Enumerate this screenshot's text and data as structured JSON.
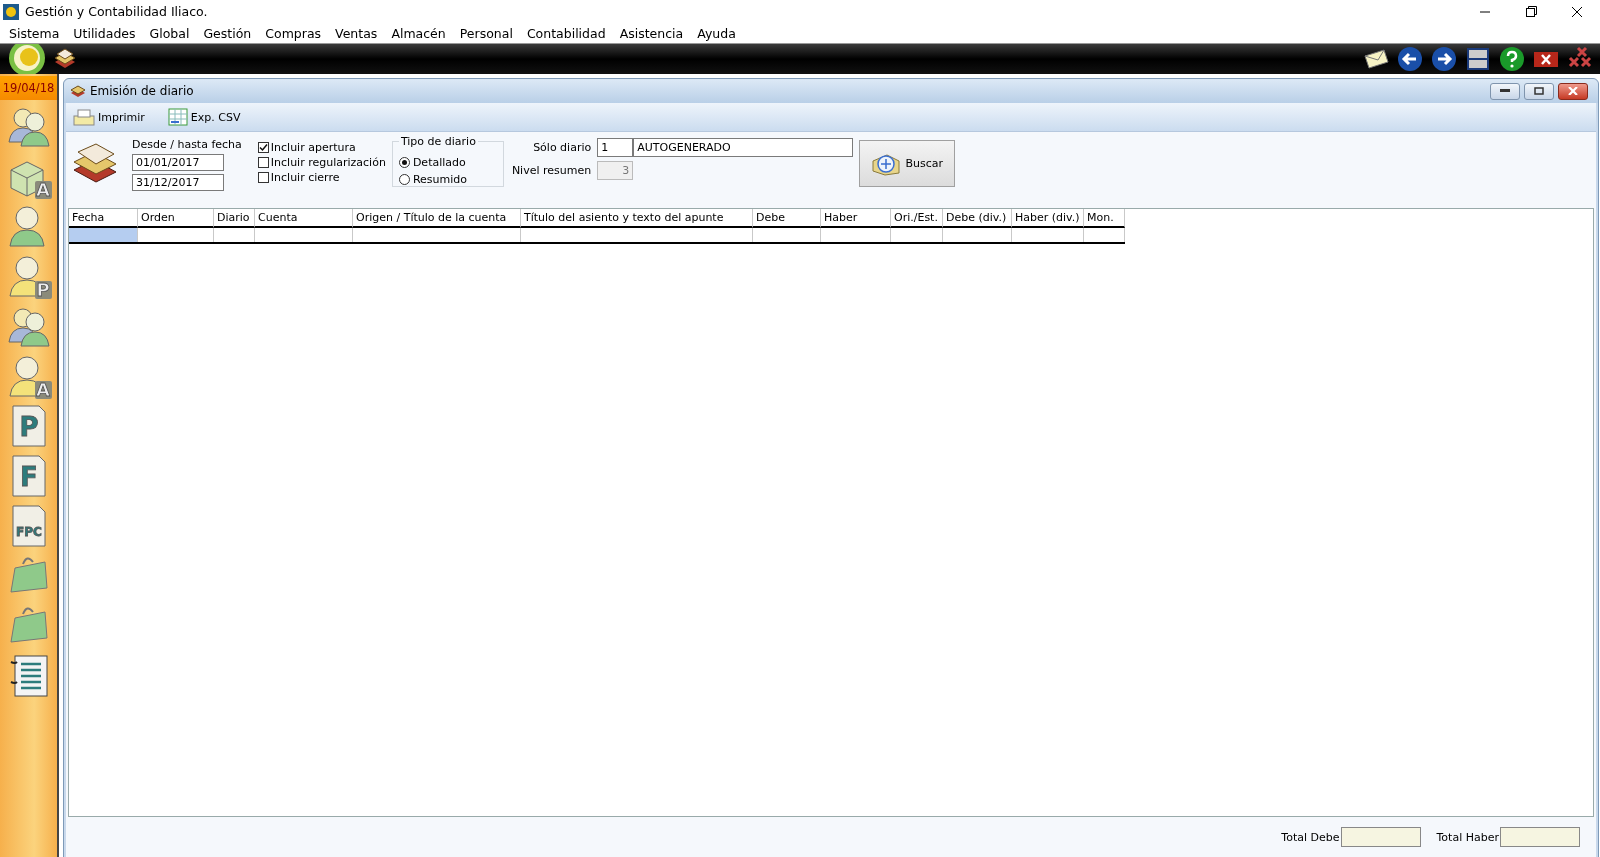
{
  "window": {
    "title": "Gestión y Contabilidad Iliaco."
  },
  "menu": [
    "Sistema",
    "Utilidades",
    "Global",
    "Gestión",
    "Compras",
    "Ventas",
    "Almacén",
    "Personal",
    "Contabilidad",
    "Asistencia",
    "Ayuda"
  ],
  "date_badge": "19/04/18",
  "sidebar": {
    "items": [
      {
        "kind": "people"
      },
      {
        "kind": "cube",
        "letter": "A"
      },
      {
        "kind": "person"
      },
      {
        "kind": "person",
        "letter": "P"
      },
      {
        "kind": "people"
      },
      {
        "kind": "person",
        "letter": "A"
      },
      {
        "kind": "doc",
        "letter": "P"
      },
      {
        "kind": "doc",
        "letter": "F"
      },
      {
        "kind": "doc",
        "letter": "FPC"
      },
      {
        "kind": "bag"
      },
      {
        "kind": "bag"
      },
      {
        "kind": "notebook"
      }
    ]
  },
  "child_window": {
    "title": "Emisión de diario",
    "toolbar": [
      "Imprimir",
      "Exp. CSV"
    ],
    "dates": {
      "label": "Desde / hasta fecha",
      "from": "01/01/2017",
      "to": "31/12/2017"
    },
    "checkboxes": [
      {
        "label": "Incluir apertura",
        "checked": true
      },
      {
        "label": "Incluir regularización",
        "checked": false
      },
      {
        "label": "Incluir cierre",
        "checked": false
      }
    ],
    "journal_type": {
      "label": "Tipo de diario",
      "options": [
        {
          "label": "Detallado",
          "selected": true
        },
        {
          "label": "Resumido",
          "selected": false
        }
      ]
    },
    "only_journal": {
      "label": "Sólo diario",
      "code": "1",
      "name": "AUTOGENERADO"
    },
    "summary_level": {
      "label": "Nivel resumen",
      "value": "3",
      "disabled": true
    },
    "search_button": "Buscar",
    "table": {
      "columns": [
        "Fecha",
        "Orden",
        "Diario",
        "Cuenta",
        "Origen / Título de la cuenta",
        "Título del asiento y texto del apunte",
        "Debe",
        "Haber",
        "Ori./Est.",
        "Debe (div.)",
        "Haber (div.)",
        "Mon."
      ],
      "rows": [
        {
          "selected": true
        }
      ]
    },
    "totals": [
      {
        "label": "Total Debe"
      },
      {
        "label": "Total Haber"
      }
    ]
  }
}
